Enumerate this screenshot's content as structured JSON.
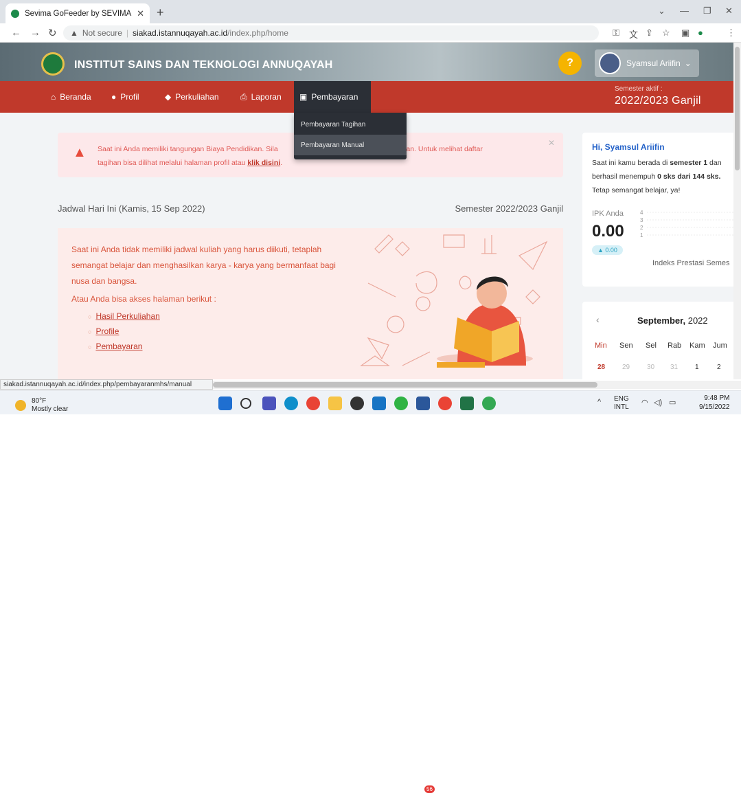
{
  "browser": {
    "tab_title": "Sevima GoFeeder by SEVIMA",
    "not_secure": "Not secure",
    "url_host": "siakad.istannuqayah.ac.id",
    "url_path": "/index.php/home",
    "status_url": "siakad.istannuqayah.ac.id/index.php/pembayaranmhs/manual"
  },
  "header": {
    "institution": "INSTITUT SAINS DAN TEKNOLOGI ANNUQAYAH",
    "user_name": "Syamsul Ariifin"
  },
  "nav": {
    "items": [
      "Beranda",
      "Profil",
      "Perkuliahan",
      "Laporan",
      "Pembayaran"
    ],
    "semester_label": "Semester aktif :",
    "semester_value": "2022/2023 Ganjil"
  },
  "dropdown": {
    "items": [
      "Pembayaran Tagihan",
      "Pembayaran Manual"
    ]
  },
  "alert": {
    "text_a": "Saat ini Anda memiliki tangungan Biaya Pendidikan. Sila",
    "text_b": "embayaran. Untuk melihat daftar",
    "text_c": "tagihan bisa dilihat melalui halaman profil atau",
    "link": "klik disini",
    "text_d": "."
  },
  "schedule": {
    "title": "Jadwal Hari Ini (Kamis, 15 Sep 2022)",
    "semester": "Semester 2022/2023 Ganjil",
    "notice": "Saat ini Anda tidak memiliki jadwal kuliah yang harus diikuti, tetaplah semangat belajar dan menghasilkan karya - karya yang bermanfaat bagi nusa dan bangsa.",
    "alt_access": "Atau Anda bisa akses halaman berikut :",
    "links": [
      "Hasil Perkuliahan",
      "Profile",
      "Pembayaran"
    ]
  },
  "summary": {
    "greeting": "Hi, Syamsul Ariifin",
    "text_1": "Saat ini kamu berada di",
    "text_sem": "semester 1",
    "text_2": "dan berhasil menempuh",
    "text_sks": "0 sks dari 144 sks.",
    "text_3": "Tetap semangat belajar, ya!",
    "ipk_label": "IPK Anda",
    "ipk_value": "0.00",
    "ipk_change": "▲ 0.00",
    "index_label": "Indeks Prestasi Semes",
    "ticks": [
      "4",
      "3",
      "2",
      "1"
    ]
  },
  "calendar": {
    "month": "September,",
    "year": "2022",
    "days": [
      "Min",
      "Sen",
      "Sel",
      "Rab",
      "Kam",
      "Jum"
    ],
    "dates": [
      "28",
      "29",
      "30",
      "31",
      "1",
      "2"
    ]
  },
  "taskbar": {
    "temp": "80°F",
    "weather": "Mostly clear",
    "lang_1": "ENG",
    "lang_2": "INTL",
    "time": "9:48 PM",
    "date": "9/15/2022",
    "badge": "56"
  }
}
